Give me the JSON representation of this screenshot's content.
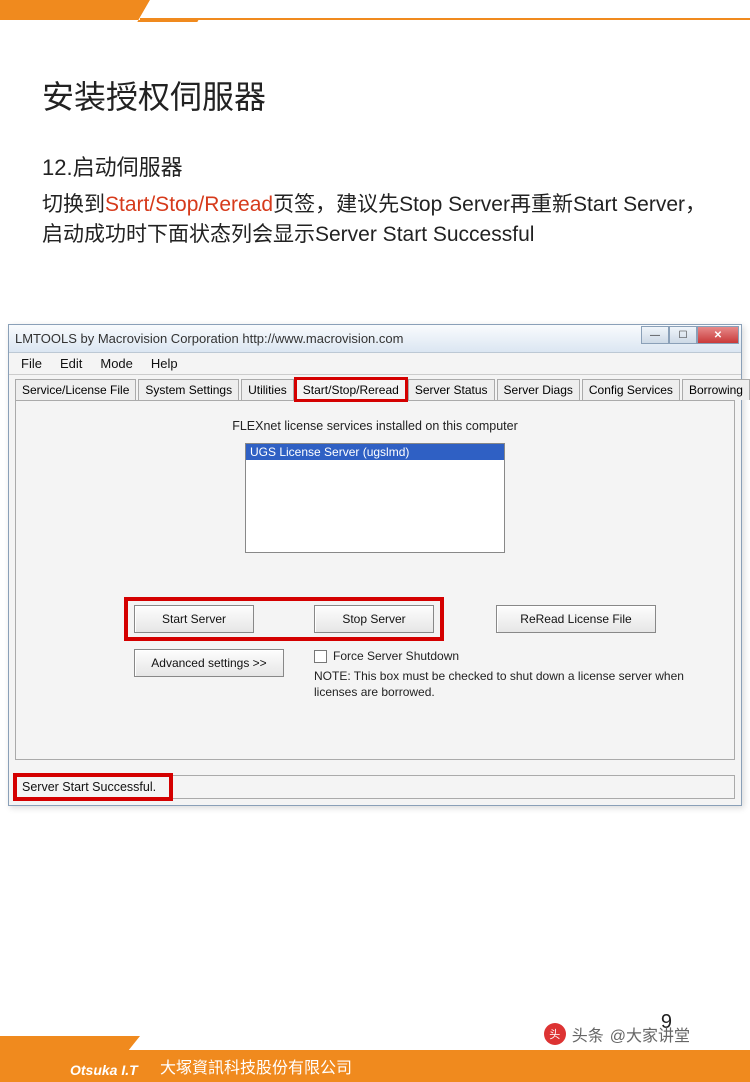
{
  "slide": {
    "title": "安装授权伺服器",
    "step_number": "12.",
    "step_title": "启动伺服器",
    "desc_before": "切换到",
    "desc_highlight": "Start/Stop/Reread",
    "desc_after": "页签，建议先Stop Server再重新Start Server，启动成功时下面状态列会显示Server Start Successful",
    "page_number": "9"
  },
  "window": {
    "title": "LMTOOLS by Macrovision Corporation http://www.macrovision.com",
    "min_icon": "—",
    "max_icon": "☐",
    "close_icon": "✕",
    "menu": [
      "File",
      "Edit",
      "Mode",
      "Help"
    ],
    "tabs": [
      {
        "label": "Service/License File",
        "active": false,
        "hl": false
      },
      {
        "label": "System Settings",
        "active": false,
        "hl": false
      },
      {
        "label": "Utilities",
        "active": false,
        "hl": false
      },
      {
        "label": "Start/Stop/Reread",
        "active": true,
        "hl": true
      },
      {
        "label": "Server Status",
        "active": false,
        "hl": false
      },
      {
        "label": "Server Diags",
        "active": false,
        "hl": false
      },
      {
        "label": "Config Services",
        "active": false,
        "hl": false
      },
      {
        "label": "Borrowing",
        "active": false,
        "hl": false
      }
    ],
    "flex_label": "FLEXnet license services installed on this computer",
    "list_selected": "UGS License Server (ugslmd)",
    "start_btn": "Start Server",
    "stop_btn": "Stop Server",
    "reread_btn": "ReRead License File",
    "adv_btn": "Advanced settings >>",
    "force_label": "Force Server Shutdown",
    "note": "NOTE:  This box must be checked to shut down a license server when licenses are borrowed.",
    "status": "Server Start Successful."
  },
  "footer": {
    "logo": "Otsuka I.T",
    "company": "大塚資訊科技股份有限公司",
    "attr_prefix": "头条",
    "attr_at": "@大家讲堂"
  }
}
